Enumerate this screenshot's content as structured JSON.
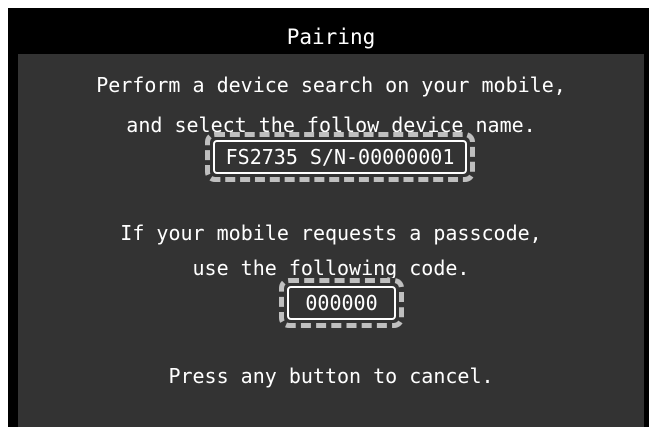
{
  "dialog": {
    "title": "Pairing",
    "search_instruction_line1": "Perform a device search on your mobile,",
    "search_instruction_line2": "and select the follow device name.",
    "device_name": "FS2735 S/N-00000001",
    "passcode_instruction_line1": "If your mobile requests a passcode,",
    "passcode_instruction_line2": "use the following code.",
    "passcode": "000000",
    "cancel_hint": "Press any button to cancel."
  },
  "colors": {
    "frame": "#000000",
    "panel": "#333333",
    "text": "#ffffff",
    "highlight_dash": "#bfbfbf"
  }
}
